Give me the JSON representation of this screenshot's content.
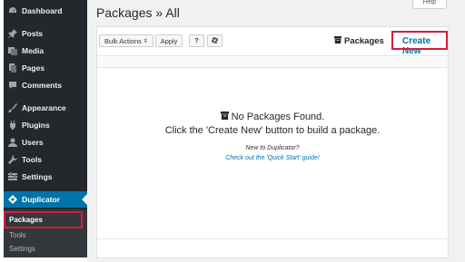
{
  "sidebar": {
    "items": [
      {
        "label": "Dashboard",
        "icon": "dashboard-icon"
      },
      {
        "label": "Posts",
        "icon": "pin-icon"
      },
      {
        "label": "Media",
        "icon": "media-icon"
      },
      {
        "label": "Pages",
        "icon": "pages-icon"
      },
      {
        "label": "Comments",
        "icon": "comment-icon"
      },
      {
        "label": "Appearance",
        "icon": "brush-icon"
      },
      {
        "label": "Plugins",
        "icon": "plugin-icon"
      },
      {
        "label": "Users",
        "icon": "user-icon"
      },
      {
        "label": "Tools",
        "icon": "wrench-icon"
      },
      {
        "label": "Settings",
        "icon": "settings-icon"
      },
      {
        "label": "Duplicator",
        "icon": "duplicator-icon"
      }
    ],
    "submenu": [
      "Packages",
      "Tools",
      "Settings"
    ]
  },
  "header": {
    "title": "Packages » All",
    "help_tab": "Help"
  },
  "toolbar": {
    "bulk_actions": "Bulk Actions",
    "apply": "Apply",
    "packages_label": "Packages",
    "create_new": "Create New"
  },
  "empty_state": {
    "title": "No Packages Found.",
    "description": "Click the 'Create New' button to build a package.",
    "new_to": "New to Duplicator?",
    "quick_start": "Check out the 'Quick Start' guide!"
  },
  "colors": {
    "accent": "#0073aa",
    "sidebar": "#23282d",
    "highlight": "#d11f3c"
  }
}
